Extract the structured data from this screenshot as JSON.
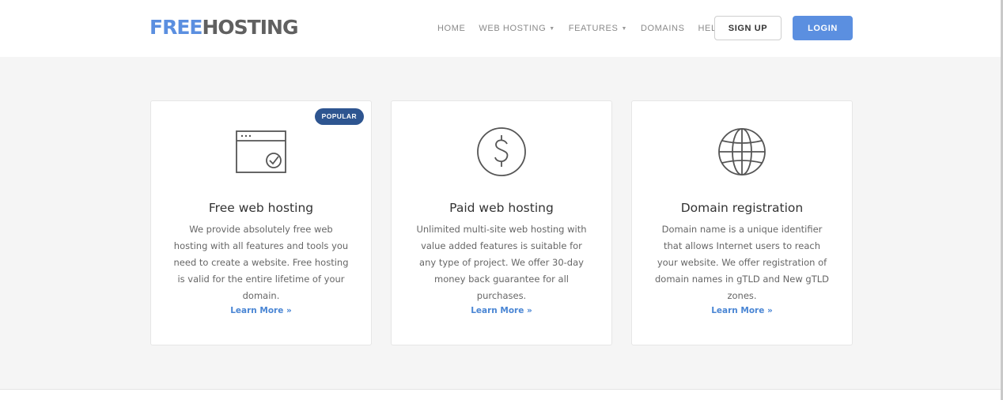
{
  "brand": {
    "part1": "FREE",
    "part2": "HOSTING",
    "color_primary": "#5b8fe0",
    "color_secondary": "#606060"
  },
  "nav": {
    "items": [
      {
        "label": "HOME",
        "has_dropdown": false
      },
      {
        "label": "WEB HOSTING",
        "has_dropdown": true
      },
      {
        "label": "FEATURES",
        "has_dropdown": true
      },
      {
        "label": "DOMAINS",
        "has_dropdown": false
      },
      {
        "label": "HELP",
        "has_dropdown": true
      }
    ],
    "caret_icon": "chevron-down-icon"
  },
  "auth": {
    "signup_label": "SIGN UP",
    "login_label": "LOGIN",
    "login_color": "#5b8fe0"
  },
  "cards": [
    {
      "icon": "browser-window-check-icon",
      "badge": "POPULAR",
      "title": "Free web hosting",
      "description": "We provide absolutely free web hosting with all features and tools you need to create a website. Free hosting is valid for the entire lifetime of your domain.",
      "link": "Learn More »"
    },
    {
      "icon": "dollar-circle-icon",
      "title": "Paid web hosting",
      "description": "Unlimited multi-site web hosting with value added features is suitable for any type of project. We offer 30-day money back guarantee for all purchases.",
      "link": "Learn More »"
    },
    {
      "icon": "globe-icon",
      "title": "Domain registration",
      "description": "Domain name is a unique identifier that allows Internet users to reach your website. We offer registration of domain names in gTLD and New gTLD zones.",
      "link": "Learn More »"
    }
  ],
  "badge_color": "#2e5590",
  "link_color": "#4a86d4"
}
